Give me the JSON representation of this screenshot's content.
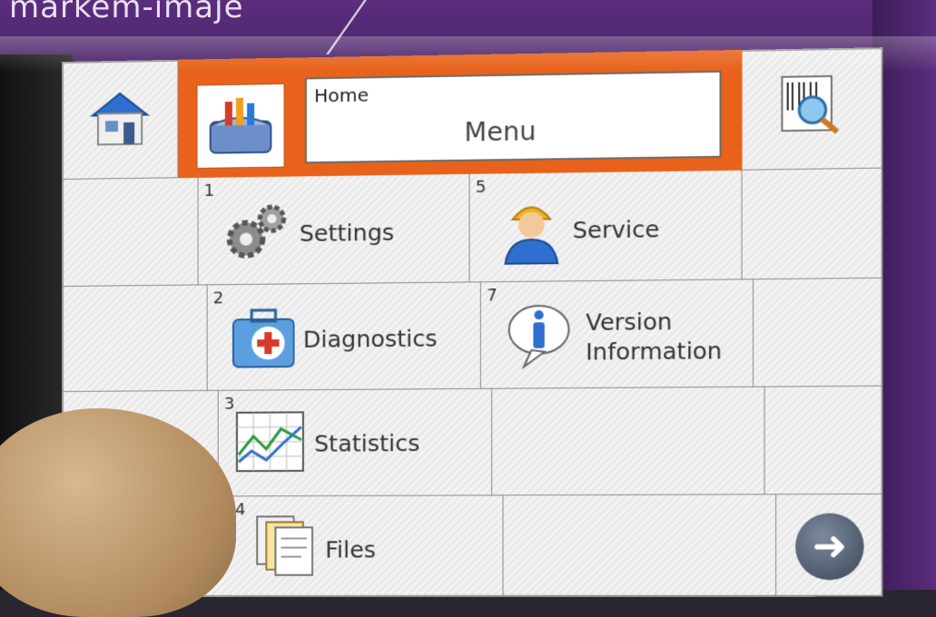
{
  "header": {
    "breadcrumb": "Home",
    "title": "Menu"
  },
  "menu": [
    {
      "num": "1",
      "label": "Settings",
      "icon": "gears-icon"
    },
    {
      "num": "2",
      "label": "Diagnostics",
      "icon": "medical-kit-icon"
    },
    {
      "num": "3",
      "label": "Statistics",
      "icon": "chart-icon"
    },
    {
      "num": "4",
      "label": "Files",
      "icon": "files-icon"
    },
    {
      "num": "5",
      "label": "Service",
      "icon": "technician-icon"
    },
    {
      "num": "7",
      "label": "Version",
      "label2": "Information",
      "icon": "info-bubble-icon"
    }
  ],
  "icons": {
    "home": "house-icon",
    "toolbox": "toolbox-icon",
    "search": "magnifier-barcode-icon",
    "next": "arrow-right-icon"
  },
  "colors": {
    "header_accent": "#e8621b",
    "bezel": "#5b2d7e"
  }
}
